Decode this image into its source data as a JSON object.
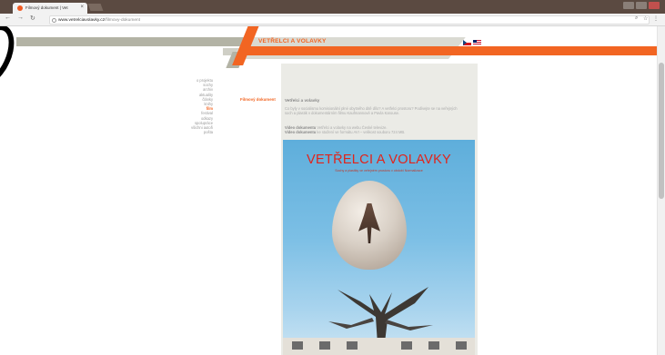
{
  "browser": {
    "tab_title": "Filmový dokument | Vet",
    "tab_close": "×",
    "url_host": "www.vetrelciavolavky.cz",
    "url_path": "/filmovy-dokument"
  },
  "site": {
    "title": "VETŘELCI A VOLAVKY",
    "menu": [
      "o projektu",
      "sochy",
      "archiv",
      "aktuality",
      "články",
      "knihy",
      "film",
      "festival",
      "odkazy",
      "spolupráce",
      "všichni autoři",
      "pošta"
    ],
    "active_menu_index": 6,
    "section_label": "Filmový dokument"
  },
  "content": {
    "title": "Vetřelci a volavky",
    "paragraph": "Co byly v socialismu komisionální plné obytného ditě dílo? A vetřelci prostoru? Podívejte se na veřejných soch a plastik v dokumentárním filmu Kaufmannové a Pavla Karouse.",
    "video1_label": "Video dokumentu",
    "video1_text": " Vetřelci a volavky na webu České televize.",
    "video2_label": "Video dokumentu",
    "video2_text": " ke stažení ve formátu AVI – velikost souboru 724 MB."
  },
  "poster": {
    "title": "VETŘELCI A VOLAVKY",
    "subtitle": "Sochy a plastiky ve veřejném prostoru v období Normalizace"
  },
  "colors": {
    "accent": "#f26522",
    "grey": "#b3b3a5",
    "content_bg": "#ebebe6"
  }
}
